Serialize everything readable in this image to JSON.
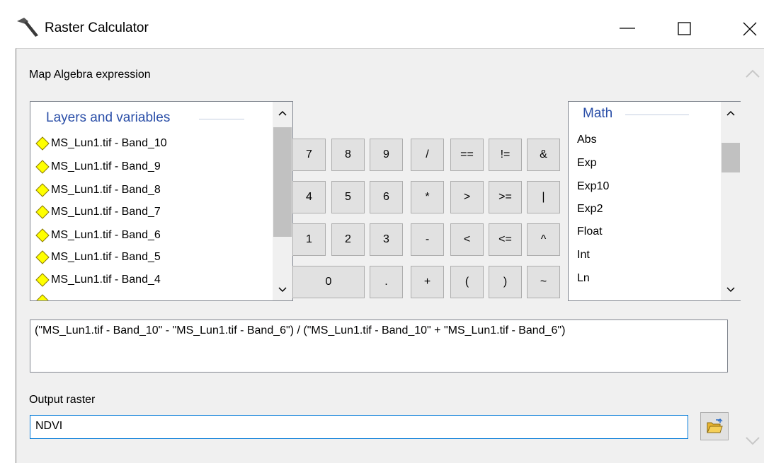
{
  "window": {
    "title": "Raster Calculator",
    "icon": "hammer-icon"
  },
  "labels": {
    "expression": "Map Algebra expression",
    "output": "Output raster"
  },
  "layers": {
    "header": "Layers and variables",
    "items": [
      "MS_Lun1.tif - Band_10",
      "MS_Lun1.tif - Band_9",
      "MS_Lun1.tif - Band_8",
      "MS_Lun1.tif - Band_7",
      "MS_Lun1.tif - Band_6",
      "MS_Lun1.tif - Band_5",
      "MS_Lun1.tif - Band_4"
    ],
    "item_icon": "raster-layer-diamond-icon",
    "item_icon_color": "#ffff00"
  },
  "math": {
    "header": "Math",
    "items": [
      "Abs",
      "Exp",
      "Exp10",
      "Exp2",
      "Float",
      "Int",
      "Ln"
    ]
  },
  "calculator": {
    "row1": [
      "7",
      "8",
      "9",
      "/",
      "==",
      "!=",
      "&"
    ],
    "row2": [
      "4",
      "5",
      "6",
      "*",
      ">",
      ">=",
      "|"
    ],
    "row3": [
      "1",
      "2",
      "3",
      "-",
      "<",
      "<=",
      "^"
    ],
    "row4": [
      "0",
      ".",
      "+",
      "(",
      ")",
      "~"
    ]
  },
  "expression_text": "(\"MS_Lun1.tif - Band_10\" - \"MS_Lun1.tif - Band_6\") / (\"MS_Lun1.tif - Band_10\" + \"MS_Lun1.tif - Band_6\")",
  "output_value": "NDVI",
  "colors": {
    "group_header": "#2b4fa8",
    "dialog_bg": "#f0f0f0",
    "button_bg": "#e1e1e1",
    "focus_border": "#0078d7"
  }
}
